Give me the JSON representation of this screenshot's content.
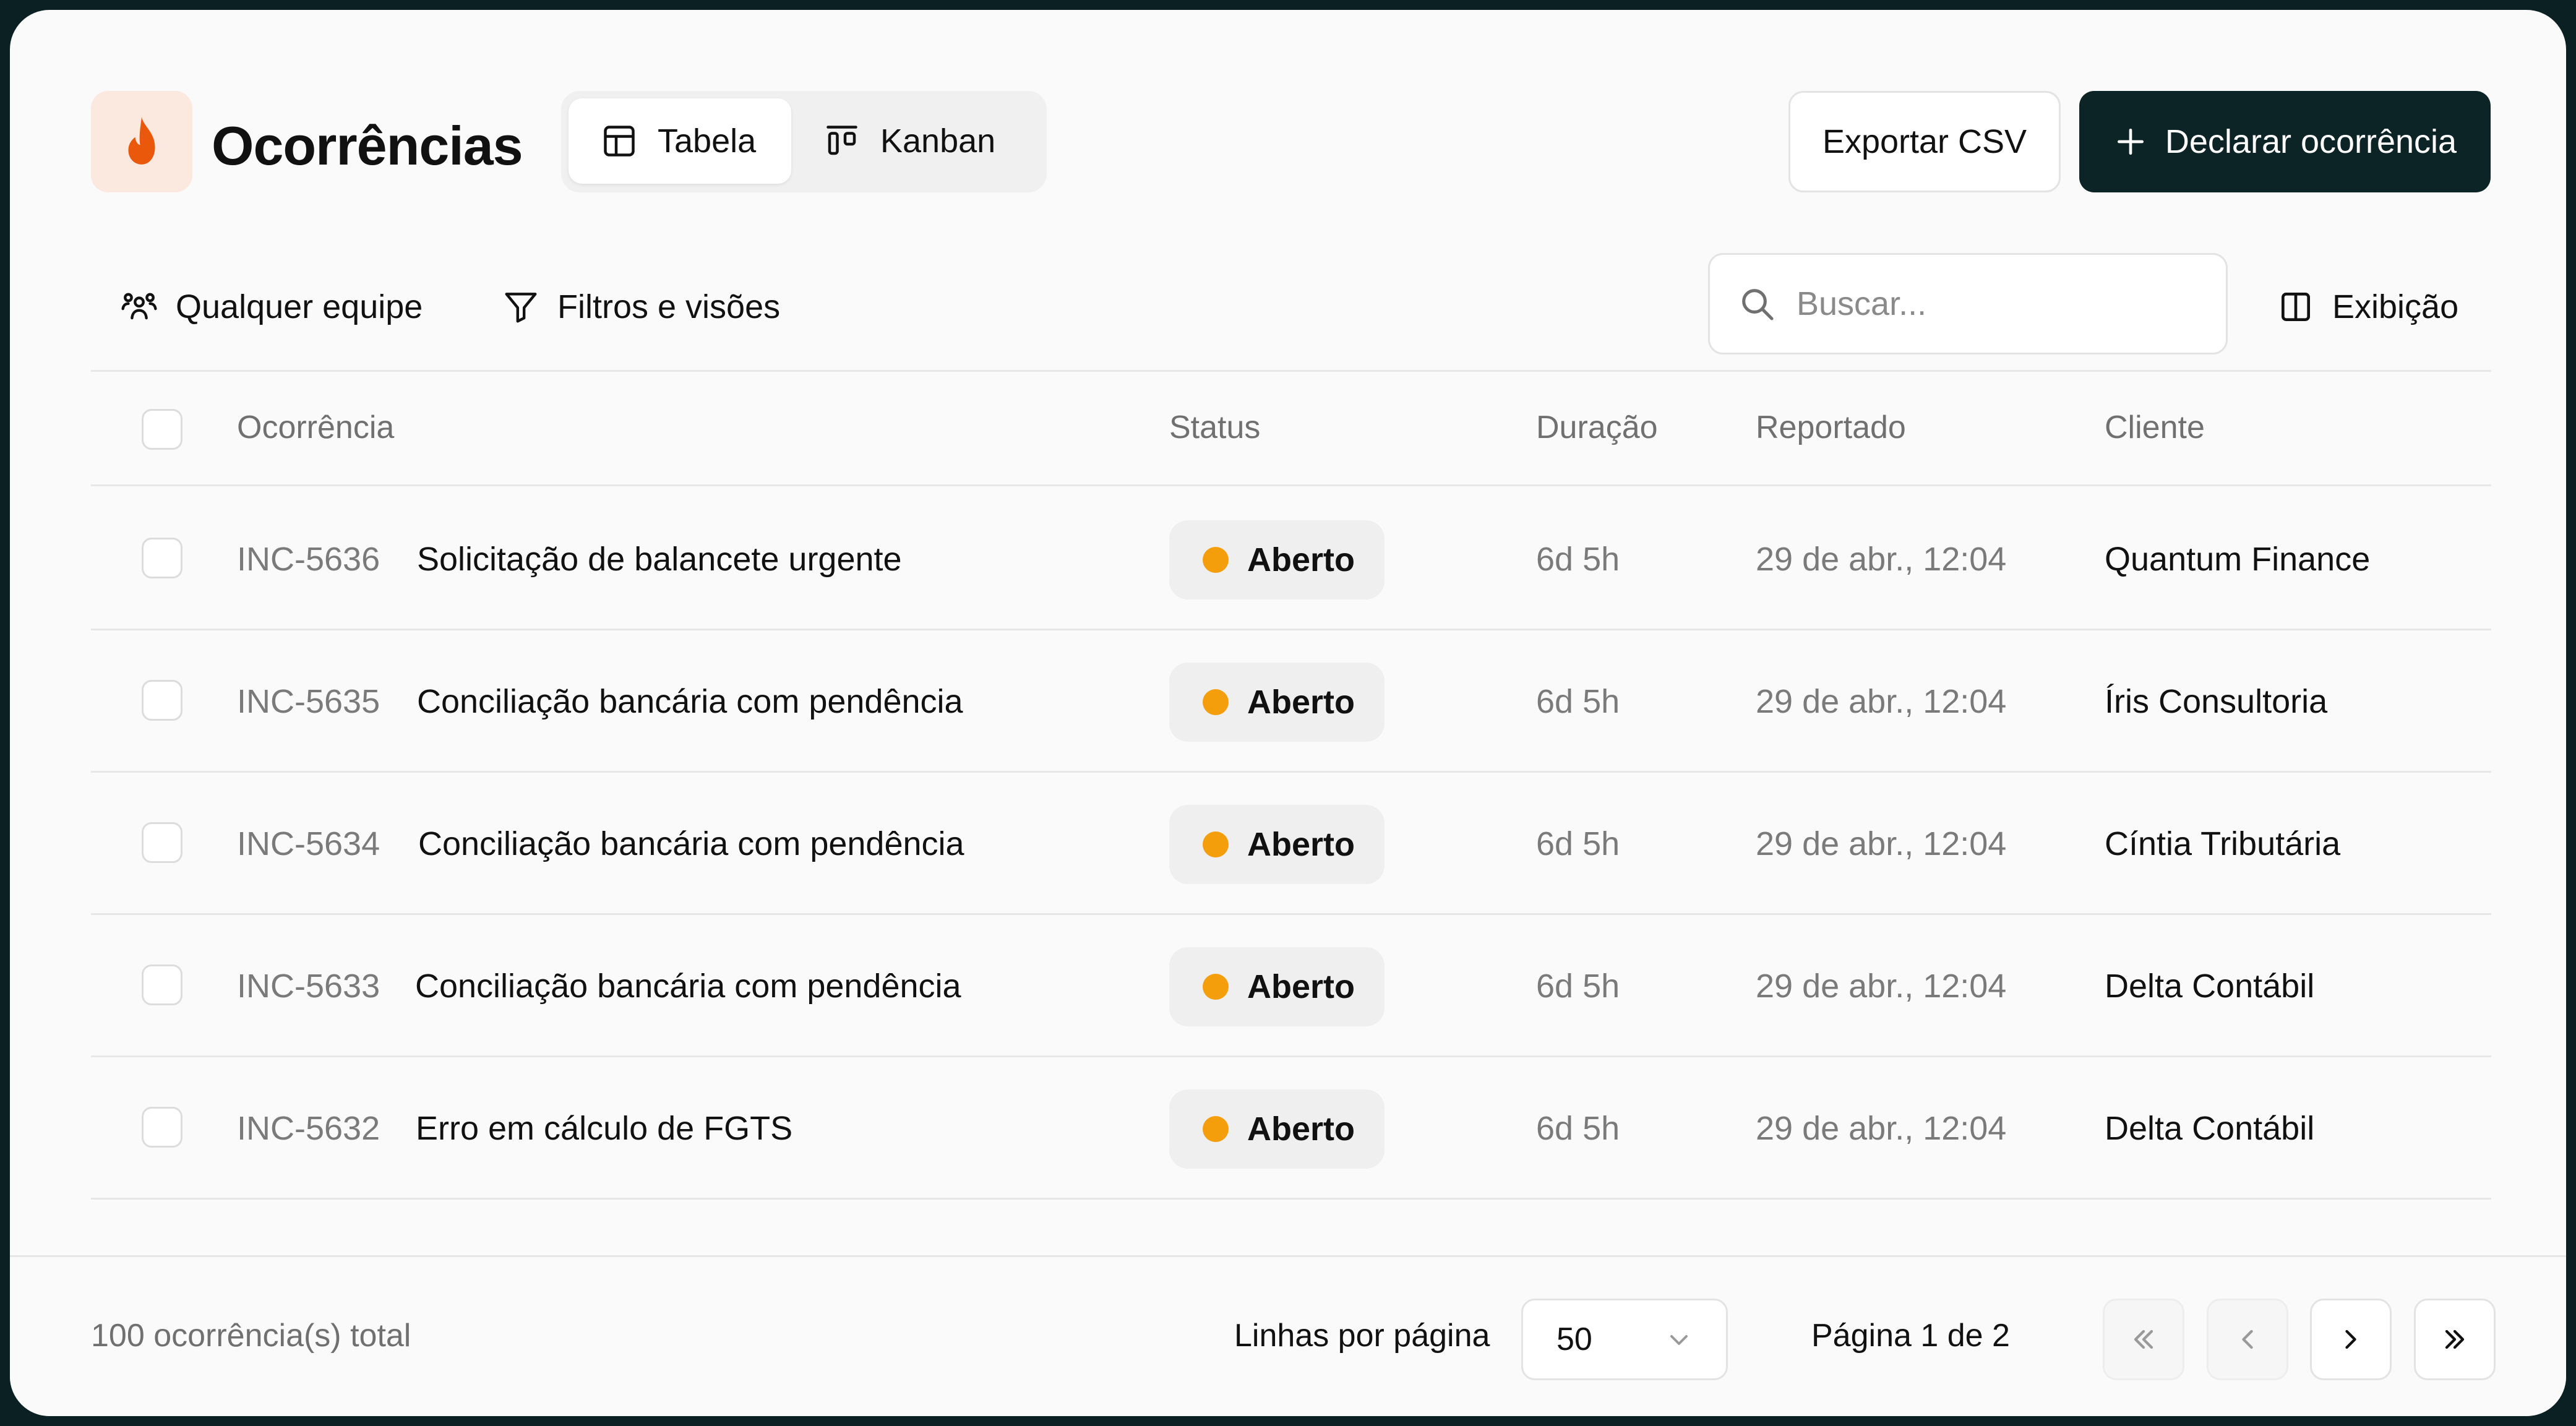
{
  "header": {
    "title": "Ocorrências",
    "view_tabs": [
      {
        "label": "Tabela",
        "icon": "table-icon",
        "active": true
      },
      {
        "label": "Kanban",
        "icon": "kanban-icon",
        "active": false
      }
    ],
    "export_label": "Exportar CSV",
    "primary_label": "Declarar ocorrência"
  },
  "toolbar": {
    "team_filter": "Qualquer equipe",
    "filters_label": "Filtros e visões",
    "search_placeholder": "Buscar...",
    "display_label": "Exibição"
  },
  "table": {
    "columns": [
      "Ocorrência",
      "Status",
      "Duração",
      "Reportado",
      "Cliente"
    ],
    "rows": [
      {
        "id": "INC-5636",
        "title": "Solicitação de balancete urgente",
        "status": "Aberto",
        "duration": "6d 5h",
        "reported": "29 de abr., 12:04",
        "client": "Quantum Finance"
      },
      {
        "id": "INC-5635",
        "title": "Conciliação bancária com pendência",
        "status": "Aberto",
        "duration": "6d 5h",
        "reported": "29 de abr., 12:04",
        "client": "Íris Consultoria"
      },
      {
        "id": "INC-5634",
        "title": "Conciliação bancária com pendência",
        "status": "Aberto",
        "duration": "6d 5h",
        "reported": "29 de abr., 12:04",
        "client": "Cíntia Tributária"
      },
      {
        "id": "INC-5633",
        "title": "Conciliação bancária com pendência",
        "status": "Aberto",
        "duration": "6d 5h",
        "reported": "29 de abr., 12:04",
        "client": "Delta Contábil"
      },
      {
        "id": "INC-5632",
        "title": "Erro em cálculo de FGTS",
        "status": "Aberto",
        "duration": "6d 5h",
        "reported": "29 de abr., 12:04",
        "client": "Delta Contábil"
      }
    ]
  },
  "footer": {
    "total": "100 ocorrência(s) total",
    "rows_per_page_label": "Linhas por página",
    "rows_per_page_value": "50",
    "page_info": "Página 1 de 2"
  },
  "colors": {
    "brand_dark": "#0c2426",
    "logo_flame": "#ea580c",
    "status_open": "#f59e0b"
  }
}
